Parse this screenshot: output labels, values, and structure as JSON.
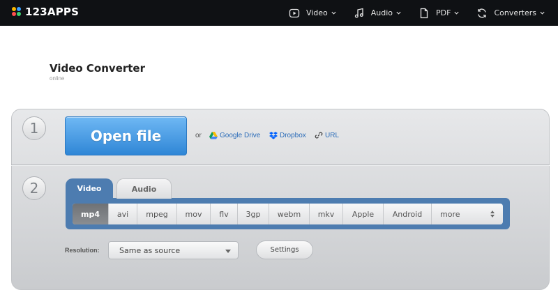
{
  "nav": {
    "logo": "123APPS",
    "items": [
      {
        "label": "Video",
        "icon": "video-icon"
      },
      {
        "label": "Audio",
        "icon": "music-icon"
      },
      {
        "label": "PDF",
        "icon": "pdf-icon"
      },
      {
        "label": "Converters",
        "icon": "converters-icon"
      }
    ]
  },
  "page": {
    "title": "Video Converter",
    "subtitle": "online"
  },
  "steps": [
    "1",
    "2"
  ],
  "open": {
    "button": "Open file",
    "or": "or",
    "sources": [
      "Google Drive",
      "Dropbox",
      "URL"
    ]
  },
  "tabs": [
    "Video",
    "Audio"
  ],
  "formats": [
    "mp4",
    "avi",
    "mpeg",
    "mov",
    "flv",
    "3gp",
    "webm",
    "mkv",
    "Apple",
    "Android",
    "more"
  ],
  "selected_format": "mp4",
  "resolution": {
    "label": "Resolution:",
    "value": "Same as source"
  },
  "settings_label": "Settings",
  "colors": {
    "accent": "#2f86d6",
    "tab": "#4d7cb0",
    "topbar": "#0f1114",
    "link": "#2a6bb8"
  }
}
